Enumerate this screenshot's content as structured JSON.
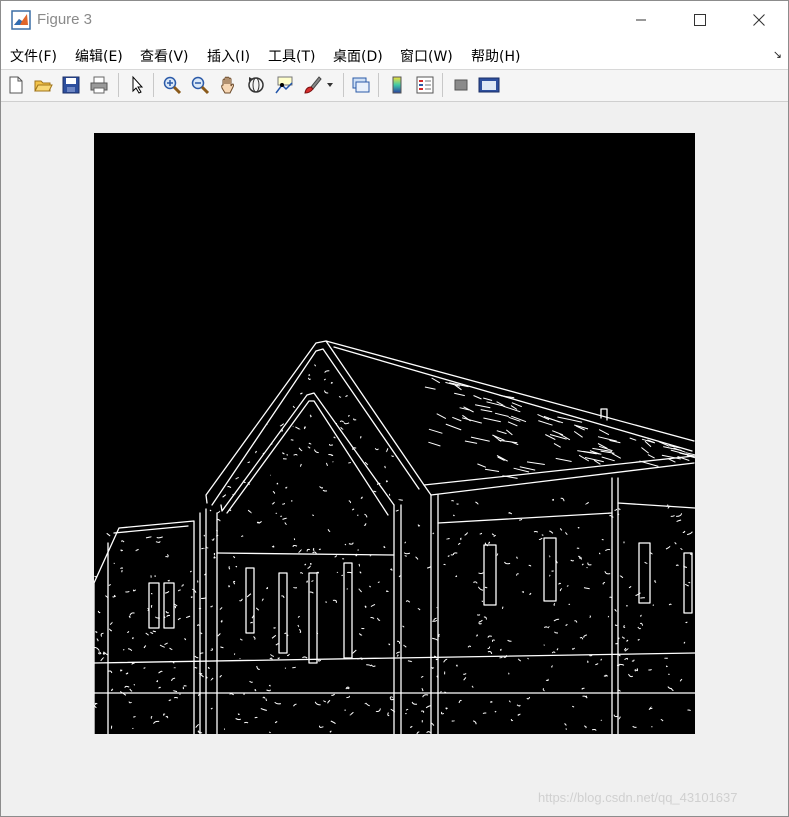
{
  "window": {
    "title": "Figure 3"
  },
  "menubar": {
    "items": [
      {
        "label": "文件(F)"
      },
      {
        "label": "编辑(E)"
      },
      {
        "label": "查看(V)"
      },
      {
        "label": "插入(I)"
      },
      {
        "label": "工具(T)"
      },
      {
        "label": "桌面(D)"
      },
      {
        "label": "窗口(W)"
      },
      {
        "label": "帮助(H)"
      }
    ],
    "overflow_icon": "dock-arrow-icon"
  },
  "toolbar": {
    "buttons": [
      {
        "icon": "new-figure-icon"
      },
      {
        "icon": "open-file-icon"
      },
      {
        "icon": "save-icon"
      },
      {
        "icon": "print-icon"
      },
      {
        "icon": "edit-plot-pointer-icon"
      },
      {
        "icon": "zoom-in-icon"
      },
      {
        "icon": "zoom-out-icon"
      },
      {
        "icon": "pan-hand-icon"
      },
      {
        "icon": "rotate-3d-icon"
      },
      {
        "icon": "data-cursor-icon"
      },
      {
        "icon": "brush-icon"
      },
      {
        "icon": "link-plot-icon"
      },
      {
        "icon": "colorbar-icon"
      },
      {
        "icon": "legend-icon"
      },
      {
        "icon": "hide-plot-tools-icon"
      },
      {
        "icon": "show-plot-tools-icon"
      }
    ]
  },
  "figure": {
    "image_description_icon": "canny-edge-image",
    "background": "#000000",
    "edge_color": "#ffffff"
  },
  "watermark": {
    "text": "https://blog.csdn.net/qq_43101637"
  }
}
